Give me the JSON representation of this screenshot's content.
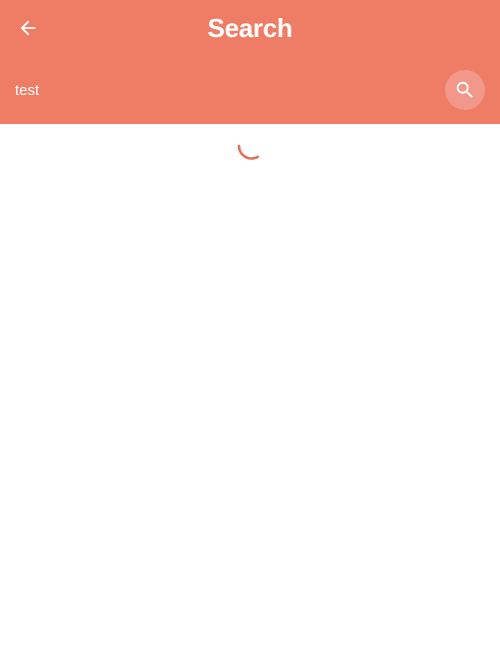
{
  "header": {
    "title": "Search",
    "back_icon": "arrow-left-icon",
    "background_color": "#ef7d66"
  },
  "search": {
    "value": "test",
    "button_icon": "search-icon",
    "button_color": "#f2988a"
  },
  "content": {
    "loading_indicator": "spinner",
    "accent_color": "#e0705a"
  }
}
